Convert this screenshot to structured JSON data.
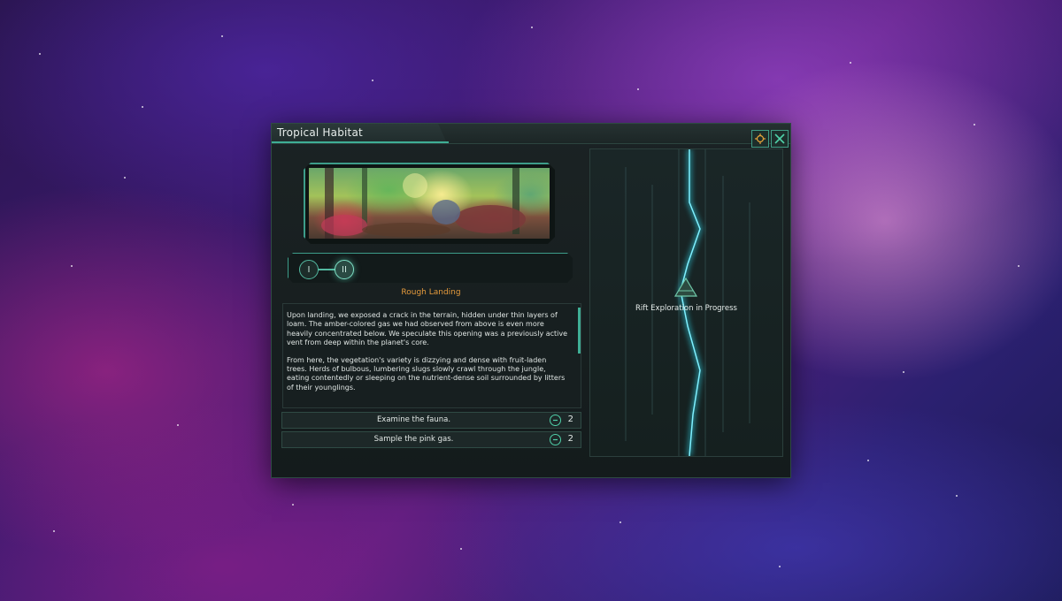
{
  "window": {
    "title": "Tropical Habitat"
  },
  "event": {
    "stages": [
      {
        "label": "I",
        "state": "done"
      },
      {
        "label": "II",
        "state": "active"
      }
    ],
    "stage_title": "Rough Landing",
    "paragraphs": [
      "Upon landing, we exposed a crack in the terrain, hidden under thin layers of loam. The amber-colored gas we had observed from above is even more heavily concentrated below. We speculate this opening was a previously active vent from deep within the planet's core.",
      "From here, the vegetation's variety is dizzying and dense with fruit-laden trees. Herds of bulbous, lumbering slugs slowly crawl through the jungle, eating contentedly or sleeping on the nutrient-dense soil surrounded by litters of their younglings."
    ],
    "options": [
      {
        "label": "Examine the fauna.",
        "count": "2",
        "icon": "speed-clock-icon"
      },
      {
        "label": "Sample the pink gas.",
        "count": "2",
        "icon": "speed-clock-icon"
      }
    ]
  },
  "rift": {
    "status": "Rift Exploration in Progress",
    "icon": "rift-marker-icon"
  },
  "icons": {
    "locate": "locate-planet-icon",
    "close": "close-icon"
  },
  "colors": {
    "accent": "#3fae95",
    "stage_title": "#e49a3c",
    "rift_glow": "#2fd3e6"
  }
}
